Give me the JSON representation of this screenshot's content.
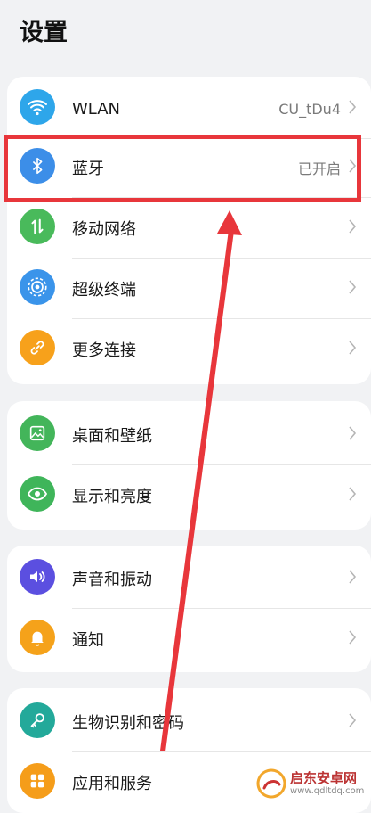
{
  "page_title": "设置",
  "cards": [
    {
      "rows": [
        {
          "label": "WLAN",
          "value": "CU_tDu4",
          "icon": "wifi-icon",
          "color": "#2ea6ea"
        },
        {
          "label": "蓝牙",
          "value": "已开启",
          "icon": "bluetooth-icon",
          "color": "#3c8ee8"
        },
        {
          "label": "移动网络",
          "value": "",
          "icon": "mobile-network-icon",
          "color": "#49ba5b"
        },
        {
          "label": "超级终端",
          "value": "",
          "icon": "super-device-icon",
          "color": "#3a94ea"
        },
        {
          "label": "更多连接",
          "value": "",
          "icon": "link-icon",
          "color": "#f7a11b"
        }
      ]
    },
    {
      "rows": [
        {
          "label": "桌面和壁纸",
          "value": "",
          "icon": "wallpaper-icon",
          "color": "#43b55a"
        },
        {
          "label": "显示和亮度",
          "value": "",
          "icon": "eye-icon",
          "color": "#3fb55a"
        }
      ]
    },
    {
      "rows": [
        {
          "label": "声音和振动",
          "value": "",
          "icon": "speaker-icon",
          "color": "#5b4fe0"
        },
        {
          "label": "通知",
          "value": "",
          "icon": "bell-icon",
          "color": "#f5a21a"
        }
      ]
    },
    {
      "rows": [
        {
          "label": "生物识别和密码",
          "value": "",
          "icon": "key-icon",
          "color": "#23a99a"
        },
        {
          "label": "应用和服务",
          "value": "",
          "icon": "apps-icon",
          "color": "#f59d1a"
        }
      ]
    }
  ],
  "annotation": {
    "color": "#e8363b"
  },
  "watermark": {
    "name": "启东安卓网",
    "url": "www.qdltdq.com"
  }
}
